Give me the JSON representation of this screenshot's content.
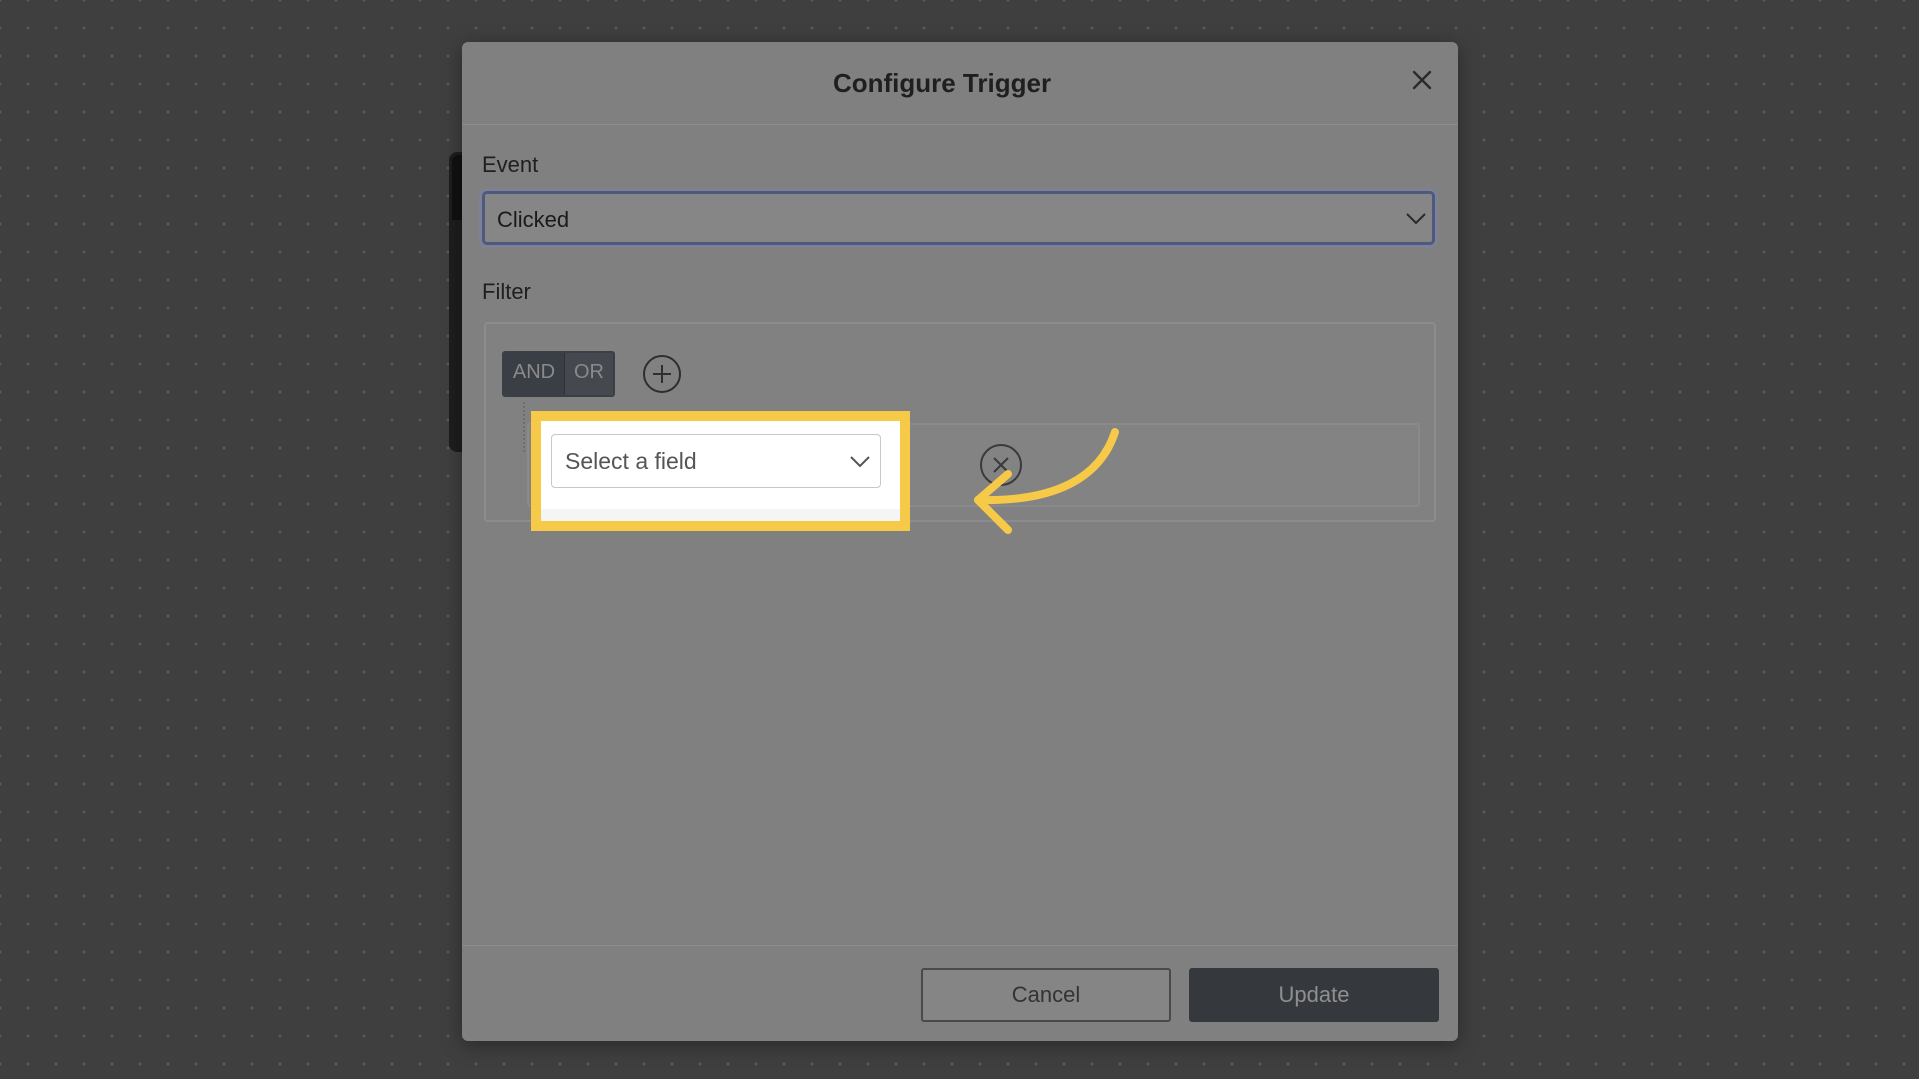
{
  "dialog": {
    "title": "Configure Trigger"
  },
  "event": {
    "label": "Event",
    "value": "Clicked"
  },
  "filter": {
    "label": "Filter",
    "logic_toggle": {
      "and_label": "AND",
      "or_label": "OR"
    },
    "rule": {
      "field_placeholder": "Select a field"
    }
  },
  "footer": {
    "cancel_label": "Cancel",
    "update_label": "Update"
  },
  "colors": {
    "highlight": "#f7c948",
    "overlay_backdrop": "#3f3f3f",
    "modal_dimmed": "#808080"
  },
  "icons": {
    "close": "close-icon",
    "event_dropdown": "chevron-down-icon",
    "add_rule": "plus-circle-icon",
    "remove_rule": "x-circle-icon",
    "field_dropdown": "chevron-down-icon",
    "pointer_arrow": "curved-arrow-icon"
  }
}
